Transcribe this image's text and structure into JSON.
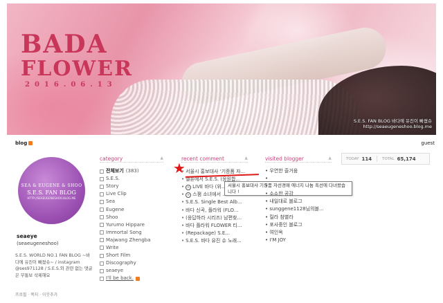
{
  "banner": {
    "title_line1": "BADA",
    "title_line2": "FLOWER",
    "date": "2016.06.13",
    "caption_line1": "S.E.S. FAN BLOG 바다에 유진이 빠졌슈",
    "caption_line2": "http://seaeugeneshoo.blog.me"
  },
  "topbar": {
    "logo": "blog",
    "guest": "guest"
  },
  "profile": {
    "image_text1": "SEA & EUGENE & SHOO",
    "image_text2": "S.E.S. FAN BLOG",
    "image_text3": "HTTP://SEAEUGENESHOO.BLOG.ME",
    "name": "seaeye",
    "id": "(seaeugeneshoo)",
    "description": "S.E.S. WORLD NO.1 FAN BLOG ~바다에 유진이 빠졌슈~ / instagram @ses971128 / S.E.S.와 관련 없는 댓글은 무통보 삭제해요",
    "links": "프로필 · 쪽지 · 이웃추가"
  },
  "category": {
    "header": "category",
    "items": [
      {
        "label": "전체보기",
        "count": "(383)"
      },
      {
        "label": "S.E.S."
      },
      {
        "label": "Story"
      },
      {
        "label": "Live Clip"
      },
      {
        "label": "Sea"
      },
      {
        "label": "Eugene"
      },
      {
        "label": "Shoo"
      },
      {
        "label": "Yurumo Hippare"
      },
      {
        "label": "Immortal Song"
      },
      {
        "label": "Majwang Zhengba"
      },
      {
        "label": "Write"
      },
      {
        "label": "Short Film"
      },
      {
        "label": "Discography"
      },
      {
        "label": "seaeye"
      },
      {
        "label": "I'll be back."
      }
    ]
  },
  "recent_comment": {
    "header": "recent comment",
    "items": [
      "서울시 홍보대사 '기증품 자...",
      "멜론에서 S.E.S. (응원합...",
      "LIVE 바다 (위...",
      "스잼 소녀에서 ...",
      "S.E.S. Single Best Alb...",
      "바다 신곡, 플라워 (FLO...",
      "(응답하라 시리즈) 남편찾...",
      "바다 플라워 FLOWER 티...",
      "(Repackage) S.E...",
      "S.E.S. 바다 유진 슈 노래..."
    ],
    "tooltip": "서울시 홍보대사 기증품 자선경매 에너지 나눔 흑선에 다녀왔습니다 !"
  },
  "visited_blogger": {
    "header": "visited blogger",
    "items": [
      "• 우연한 즐거움",
      "•",
      "•",
      "• 소소한 공감",
      "• 내일대로 블로그",
      "• sunggene1128님의블...",
      "• 릴라 참별라",
      "• 포사중인 블로그",
      "• 여인옥",
      "• I'M JOY"
    ]
  },
  "counter": {
    "today_label": "TODAY",
    "today": "114",
    "total_label": "TOTAL",
    "total": "65,174"
  },
  "colors": {
    "accent": "#c3467b",
    "highlight": "#e01818",
    "brand": "#f07c22"
  }
}
